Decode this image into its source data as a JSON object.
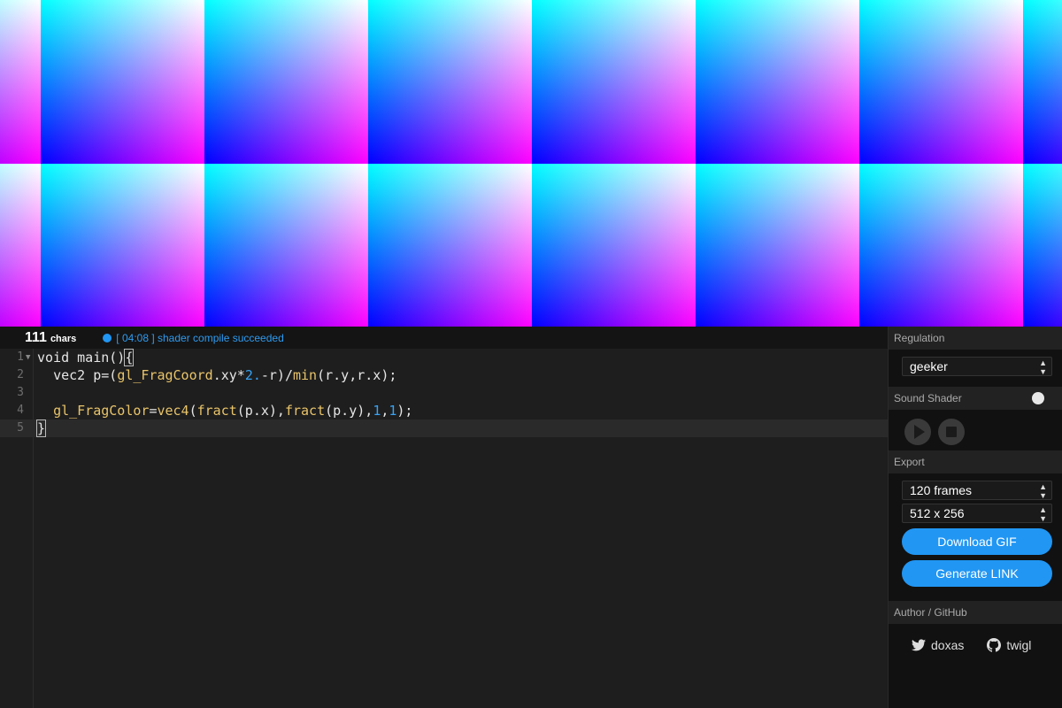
{
  "editor": {
    "chars_count": "111",
    "chars_unit": "chars",
    "status_message": "[ 04:08 ] shader compile succeeded",
    "lines": [
      {
        "num": "1"
      },
      {
        "num": "2"
      },
      {
        "num": "3"
      },
      {
        "num": "4"
      },
      {
        "num": "5"
      }
    ]
  },
  "panel": {
    "regulation": {
      "title": "Regulation",
      "selected": "geeker"
    },
    "sound": {
      "title": "Sound Shader",
      "enabled": false
    },
    "export": {
      "title": "Export",
      "frames_selected": "120 frames",
      "size_selected": "512 x 256",
      "download_label": "Download GIF",
      "link_label": "Generate LINK"
    },
    "author": {
      "title": "Author / GitHub",
      "twitter_name": "doxas",
      "github_name": "twigl"
    }
  },
  "colors": {
    "accent": "#2196f3",
    "function": "#e9c46a",
    "number": "#36a3f5"
  },
  "icons": [
    "play-icon",
    "stop-icon",
    "twitter-icon",
    "github-icon",
    "chevron-updown-icon",
    "fold-arrow-icon"
  ]
}
